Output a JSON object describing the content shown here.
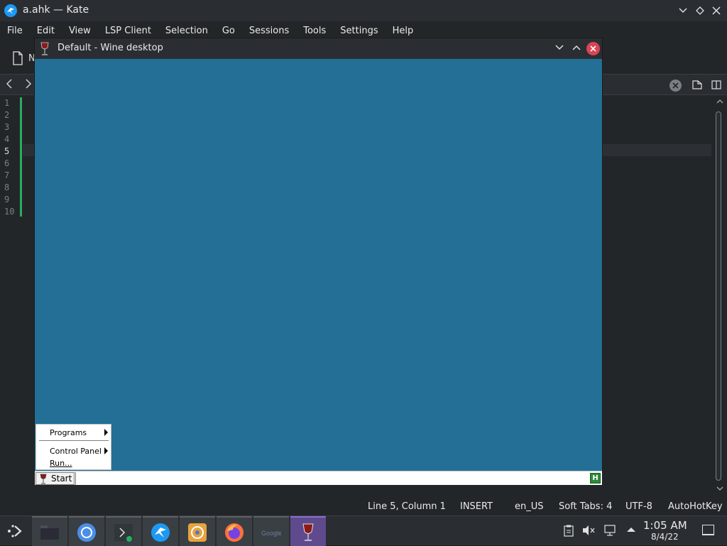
{
  "kate": {
    "title": "a.ahk — Kate",
    "menu": [
      "File",
      "Edit",
      "View",
      "LSP Client",
      "Selection",
      "Go",
      "Sessions",
      "Tools",
      "Settings",
      "Help"
    ],
    "toolbar": {
      "new_label": "N"
    },
    "line_numbers": [
      "1",
      "2",
      "3",
      "4",
      "5",
      "6",
      "7",
      "8",
      "9",
      "10"
    ],
    "current_line": 5,
    "status": {
      "position": "Line 5, Column 1",
      "mode": "INSERT",
      "dictionary": "en_US",
      "indentation": "Soft Tabs: 4",
      "encoding": "UTF-8",
      "syntax": "AutoHotKey"
    },
    "colors": {
      "accent_green": "#27ae60",
      "background": "#232629"
    }
  },
  "wine": {
    "title": "Default - Wine desktop",
    "desktop_color": "#236f96",
    "start_menu": {
      "items": [
        "Programs",
        "Control Panel",
        "Run..."
      ]
    },
    "start_label": "Start",
    "tray_label": "H"
  },
  "panel": {
    "tasks": [
      "file-manager",
      "chromium",
      "konsole",
      "kate",
      "blender",
      "firefox",
      "google",
      "wine"
    ],
    "google_label": "Google",
    "clock": {
      "time": "1:05 AM",
      "date": "8/4/22"
    }
  }
}
